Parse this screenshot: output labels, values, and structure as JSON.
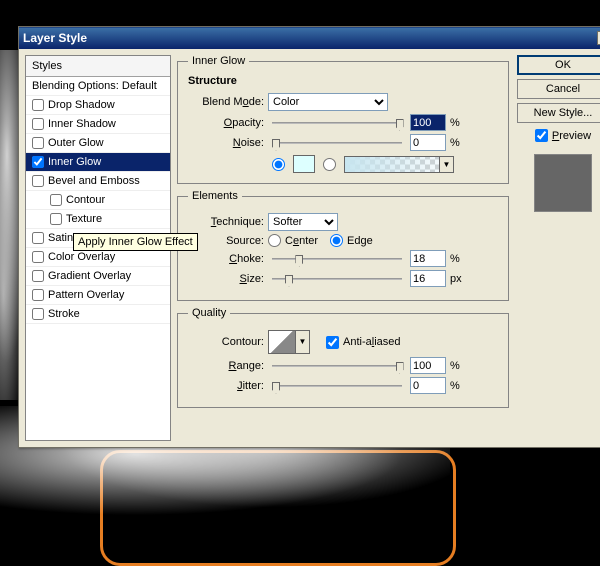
{
  "dialog": {
    "title": "Layer Style"
  },
  "styles_panel": {
    "header": "Styles",
    "blending": "Blending Options: Default",
    "items": [
      {
        "label": "Drop Shadow",
        "checked": false
      },
      {
        "label": "Inner Shadow",
        "checked": false
      },
      {
        "label": "Outer Glow",
        "checked": false
      },
      {
        "label": "Inner Glow",
        "checked": true,
        "selected": true
      },
      {
        "label": "Bevel and Emboss",
        "checked": false
      },
      {
        "label": "Contour",
        "checked": false,
        "indent": true
      },
      {
        "label": "Texture",
        "checked": false,
        "indent": true
      },
      {
        "label": "Satin",
        "checked": false
      },
      {
        "label": "Color Overlay",
        "checked": false
      },
      {
        "label": "Gradient Overlay",
        "checked": false
      },
      {
        "label": "Pattern Overlay",
        "checked": false
      },
      {
        "label": "Stroke",
        "checked": false
      }
    ],
    "tooltip": "Apply Inner Glow Effect"
  },
  "settings": {
    "title": "Inner Glow",
    "structure": {
      "title": "Structure",
      "blend_mode_label": "Blend Mode:",
      "blend_mode_value": "Color",
      "opacity_label": "Opacity:",
      "opacity_value": "100",
      "noise_label": "Noise:",
      "noise_value": "0",
      "unit_pct": "%"
    },
    "elements": {
      "title": "Elements",
      "technique_label": "Technique:",
      "technique_value": "Softer",
      "source_label": "Source:",
      "center_label": "Center",
      "edge_label": "Edge",
      "choke_label": "Choke:",
      "choke_value": "18",
      "size_label": "Size:",
      "size_value": "16",
      "unit_pct": "%",
      "unit_px": "px"
    },
    "quality": {
      "title": "Quality",
      "contour_label": "Contour:",
      "antialiased_label": "Anti-aliased",
      "range_label": "Range:",
      "range_value": "100",
      "jitter_label": "Jitter:",
      "jitter_value": "0",
      "unit_pct": "%"
    }
  },
  "buttons": {
    "ok": "OK",
    "cancel": "Cancel",
    "new_style": "New Style...",
    "preview_label": "Preview"
  }
}
